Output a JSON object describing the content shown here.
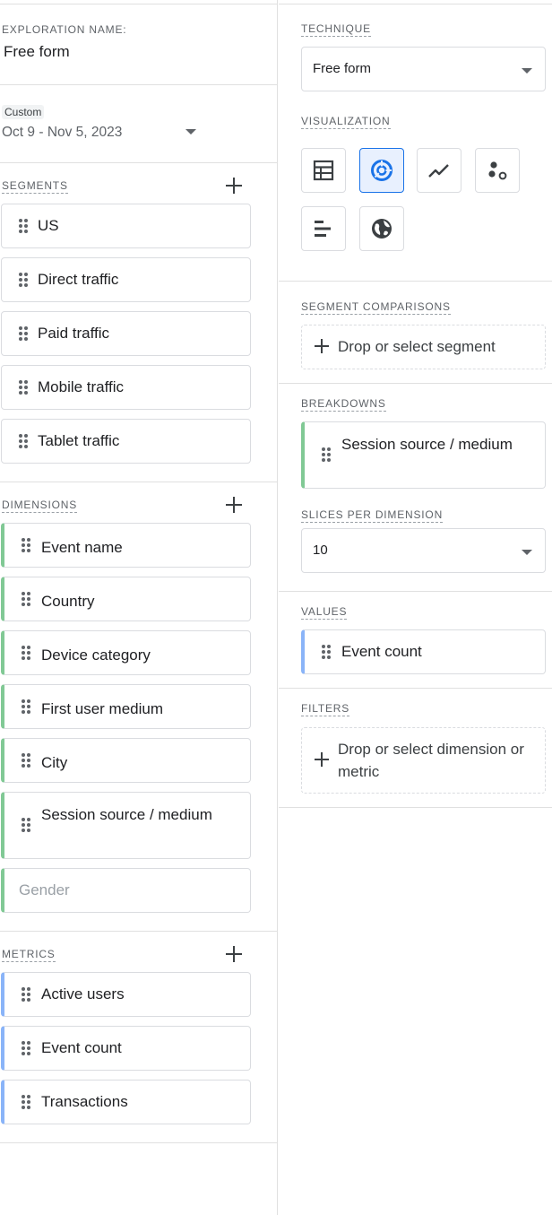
{
  "exploration": {
    "label": "EXPLORATION NAME:",
    "value": "Free form"
  },
  "date_range": {
    "badge": "Custom",
    "range": "Oct 9 - Nov 5, 2023"
  },
  "segments": {
    "label": "SEGMENTS",
    "items": [
      "US",
      "Direct traffic",
      "Paid traffic",
      "Mobile traffic",
      "Tablet traffic"
    ]
  },
  "dimensions": {
    "label": "DIMENSIONS",
    "items": [
      "Event name",
      "Country",
      "Device category",
      "First user medium",
      "City",
      "Session source / medium"
    ],
    "placeholder_item": "Gender"
  },
  "metrics": {
    "label": "METRICS",
    "items": [
      "Active users",
      "Event count",
      "Transactions"
    ]
  },
  "technique": {
    "label": "TECHNIQUE",
    "value": "Free form"
  },
  "visualization": {
    "label": "VISUALIZATION",
    "buttons": [
      "table-icon",
      "donut-chart-icon",
      "line-chart-icon",
      "scatter-plot-icon",
      "bar-chart-icon",
      "geo-map-icon"
    ],
    "selected": "donut-chart-icon"
  },
  "segment_comparisons": {
    "label": "SEGMENT COMPARISONS",
    "drop_text": "Drop or select segment"
  },
  "breakdowns": {
    "label": "BREAKDOWNS",
    "item": "Session source / medium"
  },
  "slices": {
    "label": "SLICES PER DIMENSION",
    "value": "10"
  },
  "values": {
    "label": "VALUES",
    "item": "Event count"
  },
  "filters": {
    "label": "FILTERS",
    "drop_text": "Drop or select dimension or metric"
  },
  "colors": {
    "accent": "#1a73e8",
    "dimension_bar": "#81c995",
    "metric_bar": "#8ab4f8"
  }
}
